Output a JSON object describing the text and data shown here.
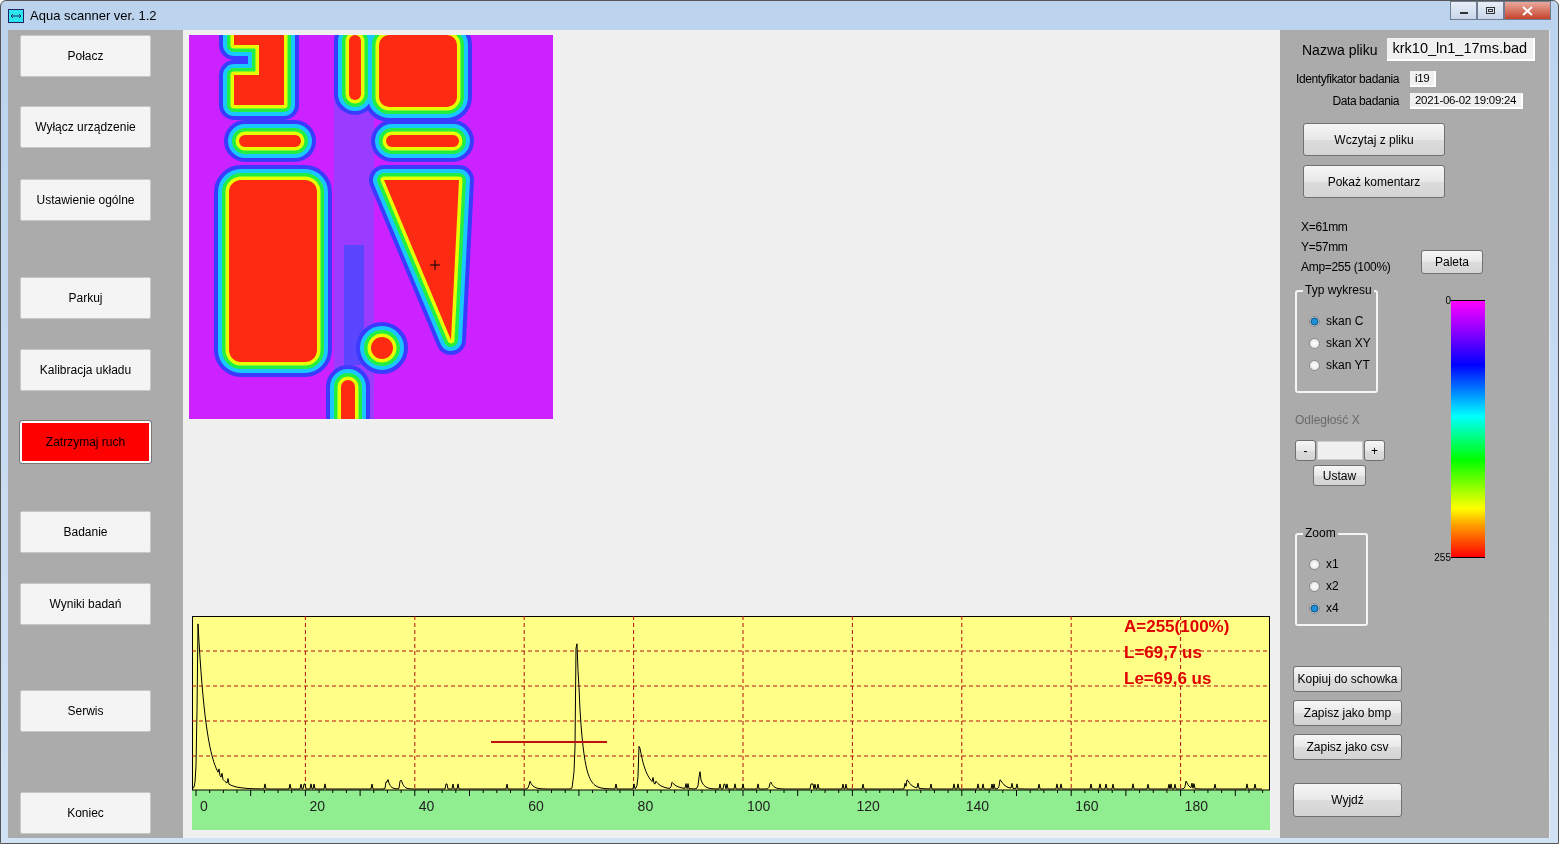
{
  "window": {
    "title": "Aqua scanner ver. 1.2"
  },
  "sidebar": {
    "buttons": [
      {
        "label": "Połacz",
        "kind": "normal"
      },
      {
        "label": "Wyłącz urządzenie",
        "kind": "normal"
      },
      {
        "label": "Ustawienie ogólne",
        "kind": "normal"
      },
      {
        "label": "Parkuj",
        "kind": "normal"
      },
      {
        "label": "Kalibracja układu",
        "kind": "normal"
      },
      {
        "label": "Zatrzymaj ruch",
        "kind": "alert"
      },
      {
        "label": "Badanie",
        "kind": "normal"
      },
      {
        "label": "Wyniki badań",
        "kind": "normal"
      },
      {
        "label": "Serwis",
        "kind": "normal"
      },
      {
        "label": "Koniec",
        "kind": "normal"
      }
    ]
  },
  "a_scan": {
    "readouts": [
      "A=255(100%)",
      "L=69,7 us",
      "Le=69,6 us"
    ],
    "x_axis_labels": [
      "0",
      "20",
      "40",
      "60",
      "80",
      "100",
      "120",
      "140",
      "160",
      "180"
    ]
  },
  "file_info": {
    "file_name_label": "Nazwa pliku",
    "file_name": "krk10_ln1_17ms.bad",
    "fields": [
      {
        "label": "Identyfikator badania",
        "value": "i19"
      },
      {
        "label": "Data badania",
        "value": "2021-06-02 19:09:24"
      }
    ]
  },
  "file_buttons": [
    "Wczytaj z pliku",
    "Pokaż komentarz"
  ],
  "cursor_readouts": [
    "X=61mm",
    "Y=57mm",
    "Amp=255 (100%)"
  ],
  "palette_button": "Paleta",
  "plot_type": {
    "title": "Typ wykresu",
    "options": [
      {
        "label": "skan C",
        "selected": true
      },
      {
        "label": "skan XY",
        "selected": false
      },
      {
        "label": "skan YT",
        "selected": false
      }
    ]
  },
  "distance": {
    "label": "Odległość X",
    "decrement": "-",
    "increment": "+",
    "set_button": "Ustaw"
  },
  "zoom": {
    "title": "Zoom",
    "options": [
      {
        "label": "x1",
        "selected": false
      },
      {
        "label": "x2",
        "selected": false
      },
      {
        "label": "x4",
        "selected": true
      }
    ]
  },
  "colorbar": {
    "min_label": "0",
    "max_label": "255"
  },
  "action_buttons": [
    "Kopiuj do schowka",
    "Zapisz jako bmp",
    "Zapisz jako csv",
    "Wyjdź"
  ]
}
